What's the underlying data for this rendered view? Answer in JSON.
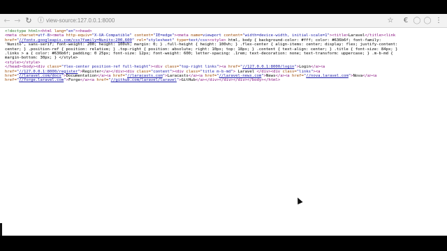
{
  "browser": {
    "url": "view-source:127.0.0.1:8000",
    "icons": {
      "back": "back-arrow-icon",
      "forward": "forward-arrow-icon",
      "reload": "reload-icon",
      "bookmark": "star-icon",
      "extension": "extension-icon",
      "account": "account-icon",
      "menu": "kebab-menu-icon"
    }
  },
  "source_lines": [
    [
      [
        "cmt",
        "<!doctype html>"
      ],
      [
        "tag",
        "<html "
      ],
      [
        "attr",
        "lang="
      ],
      [
        "val",
        "\"en\""
      ],
      [
        "tag",
        ">"
      ],
      [
        "tag",
        "<head>"
      ]
    ],
    [
      [
        "tag",
        "<meta "
      ],
      [
        "attr",
        "charset="
      ],
      [
        "val",
        "utf-8"
      ],
      [
        "tag",
        ">"
      ],
      [
        "tag",
        "<meta "
      ],
      [
        "attr",
        "http-equiv="
      ],
      [
        "val",
        "\"X-UA-Compatible\""
      ],
      [
        "attr",
        " content="
      ],
      [
        "val",
        "\"IE=edge\""
      ],
      [
        "tag",
        ">"
      ],
      [
        "tag",
        "<meta "
      ],
      [
        "attr",
        "name="
      ],
      [
        "val",
        "viewport"
      ],
      [
        "attr",
        " content="
      ],
      [
        "val",
        "\"width=device-width, initial-scale=1\""
      ],
      [
        "tag",
        ">"
      ],
      [
        "tag",
        "<title>"
      ],
      [
        "text",
        "Laravel"
      ],
      [
        "tag",
        "</title>"
      ],
      [
        "tag",
        "<link "
      ]
    ],
    [
      [
        "attr",
        "href="
      ],
      [
        "val",
        "\""
      ],
      [
        "lnk",
        "//fonts.googleapis.com/css?family=Nunito:200,600"
      ],
      [
        "val",
        "\""
      ],
      [
        "attr",
        " rel="
      ],
      [
        "val",
        "\"stylesheet\""
      ],
      [
        "attr",
        " type="
      ],
      [
        "val",
        "text/css"
      ],
      [
        "tag",
        ">"
      ],
      [
        "tag",
        "<style>"
      ],
      [
        "text",
        " html, body { background-color: #fff; color: #636b6f; font-family:"
      ]
    ],
    [
      [
        "text",
        "'Nunito', sans-serif; font-weight: 200; height: 100vh; margin: 0; } .full-height { height: 100vh; } .flex-center { align-items: center; display: flex; justify-content:"
      ]
    ],
    [
      [
        "text",
        "center; } .position-ref { position: relative; } .top-right { position: absolute; right: 10px; top: 18px; } .content { text-align: center; } .title { font-size: 84px; }"
      ]
    ],
    [
      [
        "text",
        ".links > a { color: #636b6f; padding: 0 25px; font-size: 12px; font-weight: 600; letter-spacing: .1rem; text-decoration: none; text-transform: uppercase; } .m-b-md {"
      ]
    ],
    [
      [
        "text",
        "margin-bottom: 30px; } </style>"
      ]
    ],
    [
      [
        "tag",
        "<style>"
      ],
      [
        "tag",
        "</style>"
      ]
    ],
    [
      [
        "tag",
        "</head>"
      ],
      [
        "tag",
        "<body>"
      ],
      [
        "tag",
        "<div "
      ],
      [
        "attr",
        "class="
      ],
      [
        "val",
        "\"flex-center position-ref full-height\""
      ],
      [
        "tag",
        ">"
      ],
      [
        "tag",
        "<div "
      ],
      [
        "attr",
        "class="
      ],
      [
        "val",
        "\"top-right links\""
      ],
      [
        "tag",
        ">"
      ],
      [
        "tag",
        "<a "
      ],
      [
        "attr",
        "href="
      ],
      [
        "val",
        "\""
      ],
      [
        "lnk",
        "//127.0.0.1:8000/login"
      ],
      [
        "val",
        "\""
      ],
      [
        "tag",
        ">"
      ],
      [
        "text",
        "Login"
      ],
      [
        "tag",
        "</a>"
      ],
      [
        "tag",
        "<a"
      ]
    ],
    [
      [
        "attr",
        "href="
      ],
      [
        "val",
        "\""
      ],
      [
        "lnk",
        "//127.0.0.1:8000/register"
      ],
      [
        "val",
        "\""
      ],
      [
        "tag",
        ">"
      ],
      [
        "text",
        "Register"
      ],
      [
        "tag",
        "</a>"
      ],
      [
        "tag",
        "</div>"
      ],
      [
        "tag",
        "<div "
      ],
      [
        "attr",
        "class="
      ],
      [
        "val",
        "\"content\""
      ],
      [
        "tag",
        ">"
      ],
      [
        "tag",
        "<div "
      ],
      [
        "attr",
        "class="
      ],
      [
        "val",
        "\"title m-b-md\""
      ],
      [
        "tag",
        ">"
      ],
      [
        "text",
        " Laravel "
      ],
      [
        "tag",
        "</div>"
      ],
      [
        "tag",
        "<div "
      ],
      [
        "attr",
        "class="
      ],
      [
        "val",
        "\"links\""
      ],
      [
        "tag",
        ">"
      ],
      [
        "tag",
        "<a"
      ]
    ],
    [
      [
        "attr",
        "href="
      ],
      [
        "val",
        "\""
      ],
      [
        "lnk",
        "//laravel.com/docs"
      ],
      [
        "val",
        "\""
      ],
      [
        "tag",
        ">"
      ],
      [
        "text",
        "Documentation"
      ],
      [
        "tag",
        "</a>"
      ],
      [
        "tag",
        "<a "
      ],
      [
        "attr",
        "href="
      ],
      [
        "val",
        "\""
      ],
      [
        "lnk",
        "//laracasts.com"
      ],
      [
        "val",
        "\""
      ],
      [
        "tag",
        ">"
      ],
      [
        "text",
        "Laracasts"
      ],
      [
        "tag",
        "</a>"
      ],
      [
        "tag",
        "<a "
      ],
      [
        "attr",
        "href="
      ],
      [
        "val",
        "\""
      ],
      [
        "lnk",
        "//laravel-news.com"
      ],
      [
        "val",
        "\""
      ],
      [
        "tag",
        ">"
      ],
      [
        "text",
        "News"
      ],
      [
        "tag",
        "</a>"
      ],
      [
        "tag",
        "<a "
      ],
      [
        "attr",
        "href="
      ],
      [
        "val",
        "\""
      ],
      [
        "lnk",
        "//nova.laravel.com"
      ],
      [
        "val",
        "\""
      ],
      [
        "tag",
        ">"
      ],
      [
        "text",
        "Nova"
      ],
      [
        "tag",
        "</a>"
      ],
      [
        "tag",
        "<a"
      ]
    ],
    [
      [
        "attr",
        "href="
      ],
      [
        "val",
        "\""
      ],
      [
        "lnk",
        "//forge.laravel.com"
      ],
      [
        "val",
        "\""
      ],
      [
        "tag",
        ">"
      ],
      [
        "text",
        "Forge"
      ],
      [
        "tag",
        "</a>"
      ],
      [
        "tag",
        "<a "
      ],
      [
        "attr",
        "href="
      ],
      [
        "val",
        "\""
      ],
      [
        "lnk",
        "//github.com/laravel/laravel"
      ],
      [
        "val",
        "\""
      ],
      [
        "tag",
        ">"
      ],
      [
        "text",
        "GitHub"
      ],
      [
        "tag",
        "</a>"
      ],
      [
        "tag",
        "</div>"
      ],
      [
        "tag",
        "</div>"
      ],
      [
        "tag",
        "</div>"
      ],
      [
        "tag",
        "</body>"
      ],
      [
        "tag",
        "</html>"
      ]
    ]
  ]
}
